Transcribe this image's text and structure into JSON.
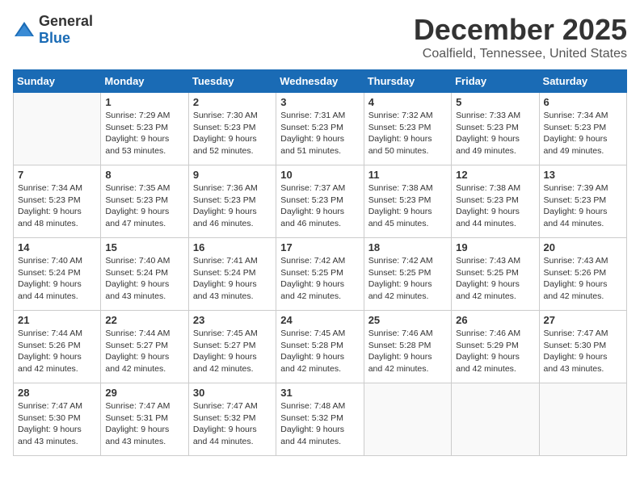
{
  "logo": {
    "text_general": "General",
    "text_blue": "Blue"
  },
  "header": {
    "month": "December 2025",
    "location": "Coalfield, Tennessee, United States"
  },
  "days_of_week": [
    "Sunday",
    "Monday",
    "Tuesday",
    "Wednesday",
    "Thursday",
    "Friday",
    "Saturday"
  ],
  "weeks": [
    [
      {
        "day": "",
        "info": ""
      },
      {
        "day": "1",
        "info": "Sunrise: 7:29 AM\nSunset: 5:23 PM\nDaylight: 9 hours\nand 53 minutes."
      },
      {
        "day": "2",
        "info": "Sunrise: 7:30 AM\nSunset: 5:23 PM\nDaylight: 9 hours\nand 52 minutes."
      },
      {
        "day": "3",
        "info": "Sunrise: 7:31 AM\nSunset: 5:23 PM\nDaylight: 9 hours\nand 51 minutes."
      },
      {
        "day": "4",
        "info": "Sunrise: 7:32 AM\nSunset: 5:23 PM\nDaylight: 9 hours\nand 50 minutes."
      },
      {
        "day": "5",
        "info": "Sunrise: 7:33 AM\nSunset: 5:23 PM\nDaylight: 9 hours\nand 49 minutes."
      },
      {
        "day": "6",
        "info": "Sunrise: 7:34 AM\nSunset: 5:23 PM\nDaylight: 9 hours\nand 49 minutes."
      }
    ],
    [
      {
        "day": "7",
        "info": "Sunrise: 7:34 AM\nSunset: 5:23 PM\nDaylight: 9 hours\nand 48 minutes."
      },
      {
        "day": "8",
        "info": "Sunrise: 7:35 AM\nSunset: 5:23 PM\nDaylight: 9 hours\nand 47 minutes."
      },
      {
        "day": "9",
        "info": "Sunrise: 7:36 AM\nSunset: 5:23 PM\nDaylight: 9 hours\nand 46 minutes."
      },
      {
        "day": "10",
        "info": "Sunrise: 7:37 AM\nSunset: 5:23 PM\nDaylight: 9 hours\nand 46 minutes."
      },
      {
        "day": "11",
        "info": "Sunrise: 7:38 AM\nSunset: 5:23 PM\nDaylight: 9 hours\nand 45 minutes."
      },
      {
        "day": "12",
        "info": "Sunrise: 7:38 AM\nSunset: 5:23 PM\nDaylight: 9 hours\nand 44 minutes."
      },
      {
        "day": "13",
        "info": "Sunrise: 7:39 AM\nSunset: 5:23 PM\nDaylight: 9 hours\nand 44 minutes."
      }
    ],
    [
      {
        "day": "14",
        "info": "Sunrise: 7:40 AM\nSunset: 5:24 PM\nDaylight: 9 hours\nand 44 minutes."
      },
      {
        "day": "15",
        "info": "Sunrise: 7:40 AM\nSunset: 5:24 PM\nDaylight: 9 hours\nand 43 minutes."
      },
      {
        "day": "16",
        "info": "Sunrise: 7:41 AM\nSunset: 5:24 PM\nDaylight: 9 hours\nand 43 minutes."
      },
      {
        "day": "17",
        "info": "Sunrise: 7:42 AM\nSunset: 5:25 PM\nDaylight: 9 hours\nand 42 minutes."
      },
      {
        "day": "18",
        "info": "Sunrise: 7:42 AM\nSunset: 5:25 PM\nDaylight: 9 hours\nand 42 minutes."
      },
      {
        "day": "19",
        "info": "Sunrise: 7:43 AM\nSunset: 5:25 PM\nDaylight: 9 hours\nand 42 minutes."
      },
      {
        "day": "20",
        "info": "Sunrise: 7:43 AM\nSunset: 5:26 PM\nDaylight: 9 hours\nand 42 minutes."
      }
    ],
    [
      {
        "day": "21",
        "info": "Sunrise: 7:44 AM\nSunset: 5:26 PM\nDaylight: 9 hours\nand 42 minutes."
      },
      {
        "day": "22",
        "info": "Sunrise: 7:44 AM\nSunset: 5:27 PM\nDaylight: 9 hours\nand 42 minutes."
      },
      {
        "day": "23",
        "info": "Sunrise: 7:45 AM\nSunset: 5:27 PM\nDaylight: 9 hours\nand 42 minutes."
      },
      {
        "day": "24",
        "info": "Sunrise: 7:45 AM\nSunset: 5:28 PM\nDaylight: 9 hours\nand 42 minutes."
      },
      {
        "day": "25",
        "info": "Sunrise: 7:46 AM\nSunset: 5:28 PM\nDaylight: 9 hours\nand 42 minutes."
      },
      {
        "day": "26",
        "info": "Sunrise: 7:46 AM\nSunset: 5:29 PM\nDaylight: 9 hours\nand 42 minutes."
      },
      {
        "day": "27",
        "info": "Sunrise: 7:47 AM\nSunset: 5:30 PM\nDaylight: 9 hours\nand 43 minutes."
      }
    ],
    [
      {
        "day": "28",
        "info": "Sunrise: 7:47 AM\nSunset: 5:30 PM\nDaylight: 9 hours\nand 43 minutes."
      },
      {
        "day": "29",
        "info": "Sunrise: 7:47 AM\nSunset: 5:31 PM\nDaylight: 9 hours\nand 43 minutes."
      },
      {
        "day": "30",
        "info": "Sunrise: 7:47 AM\nSunset: 5:32 PM\nDaylight: 9 hours\nand 44 minutes."
      },
      {
        "day": "31",
        "info": "Sunrise: 7:48 AM\nSunset: 5:32 PM\nDaylight: 9 hours\nand 44 minutes."
      },
      {
        "day": "",
        "info": ""
      },
      {
        "day": "",
        "info": ""
      },
      {
        "day": "",
        "info": ""
      }
    ]
  ]
}
